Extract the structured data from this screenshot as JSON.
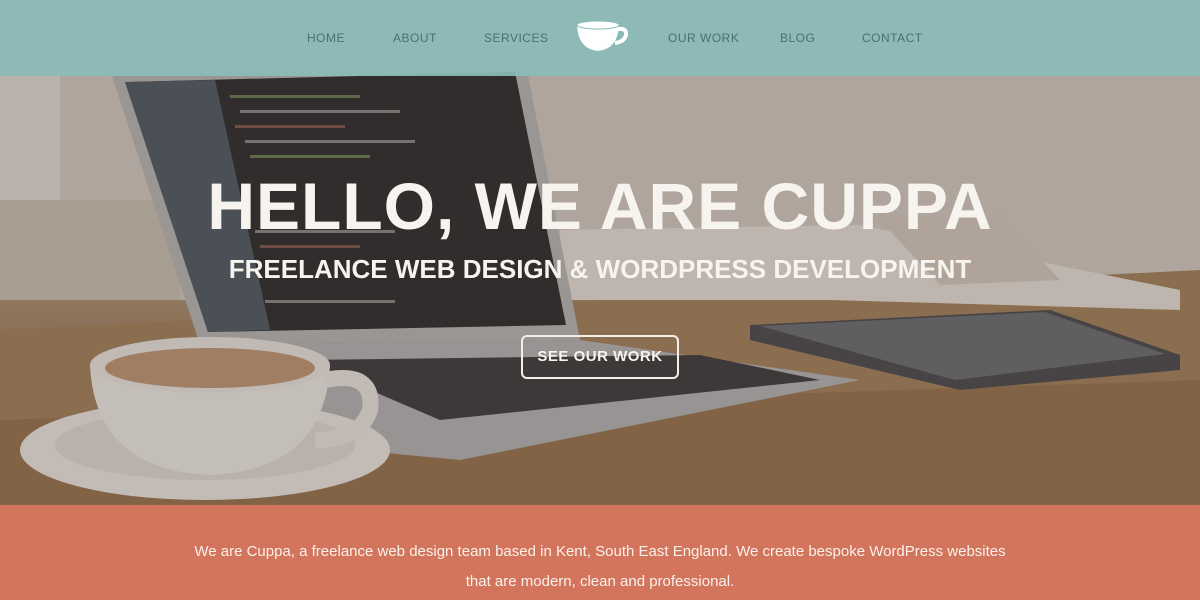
{
  "nav": {
    "items": [
      {
        "label": "HOME"
      },
      {
        "label": "ABOUT"
      },
      {
        "label": "SERVICES"
      },
      {
        "label": "OUR WORK"
      },
      {
        "label": "BLOG"
      },
      {
        "label": "CONTACT"
      }
    ],
    "logo_icon": "teacup-icon",
    "background_color": "#8bbab8"
  },
  "hero": {
    "title": "HELLO, WE ARE CUPPA",
    "subtitle": "FREELANCE WEB DESIGN & WORDPRESS DEVELOPMENT",
    "cta_label": "SEE OUR WORK"
  },
  "intro": {
    "line1": "We are Cuppa, a freelance web design team based in Kent, South East England. We create bespoke WordPress websites",
    "line2": "that are modern, clean and professional.",
    "background_color": "#d2755c"
  }
}
